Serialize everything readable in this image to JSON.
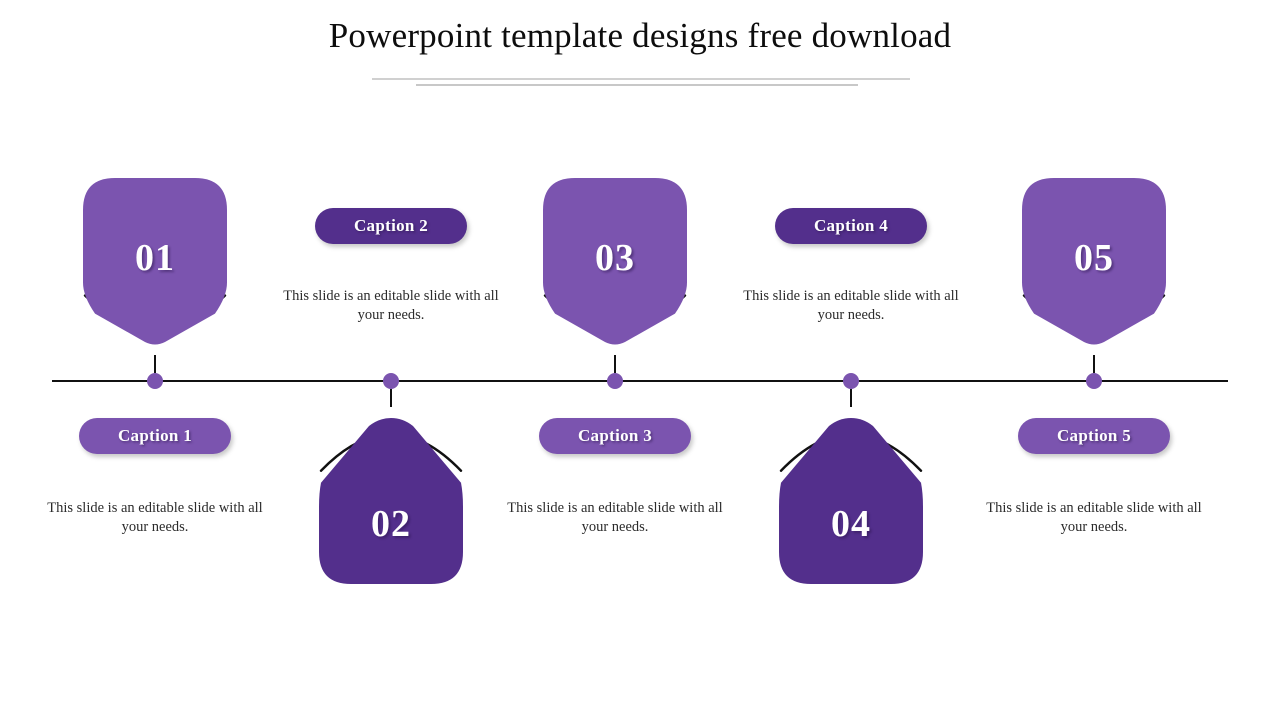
{
  "slide": {
    "title": "Powerpoint template designs free download",
    "background_color": "#ffffff",
    "rule_color": "#d0d0d0"
  },
  "theme": {
    "light_purple": "#7B54AF",
    "dark_purple": "#532F8C",
    "timeline_color": "#111111",
    "text_color": "#2b2b2b",
    "number_color": "#ffffff"
  },
  "timeline": {
    "dot_color": "#7B54AF",
    "line_color": "#111111"
  },
  "items": [
    {
      "number": "01",
      "caption": "Caption 1",
      "description": "This slide is an editable slide with all your needs.",
      "color": "#7B54AF",
      "position": "above"
    },
    {
      "number": "02",
      "caption": "Caption 2",
      "description": "This slide is an editable slide with all your needs.",
      "color": "#532F8C",
      "position": "below"
    },
    {
      "number": "03",
      "caption": "Caption 3",
      "description": "This slide is an editable slide with all your needs.",
      "color": "#7B54AF",
      "position": "above"
    },
    {
      "number": "04",
      "caption": "Caption 4",
      "description": "This slide is an editable slide with all your needs.",
      "color": "#532F8C",
      "position": "below"
    },
    {
      "number": "05",
      "caption": "Caption 5",
      "description": "This slide is an editable slide with all your needs.",
      "color": "#7B54AF",
      "position": "above"
    }
  ]
}
